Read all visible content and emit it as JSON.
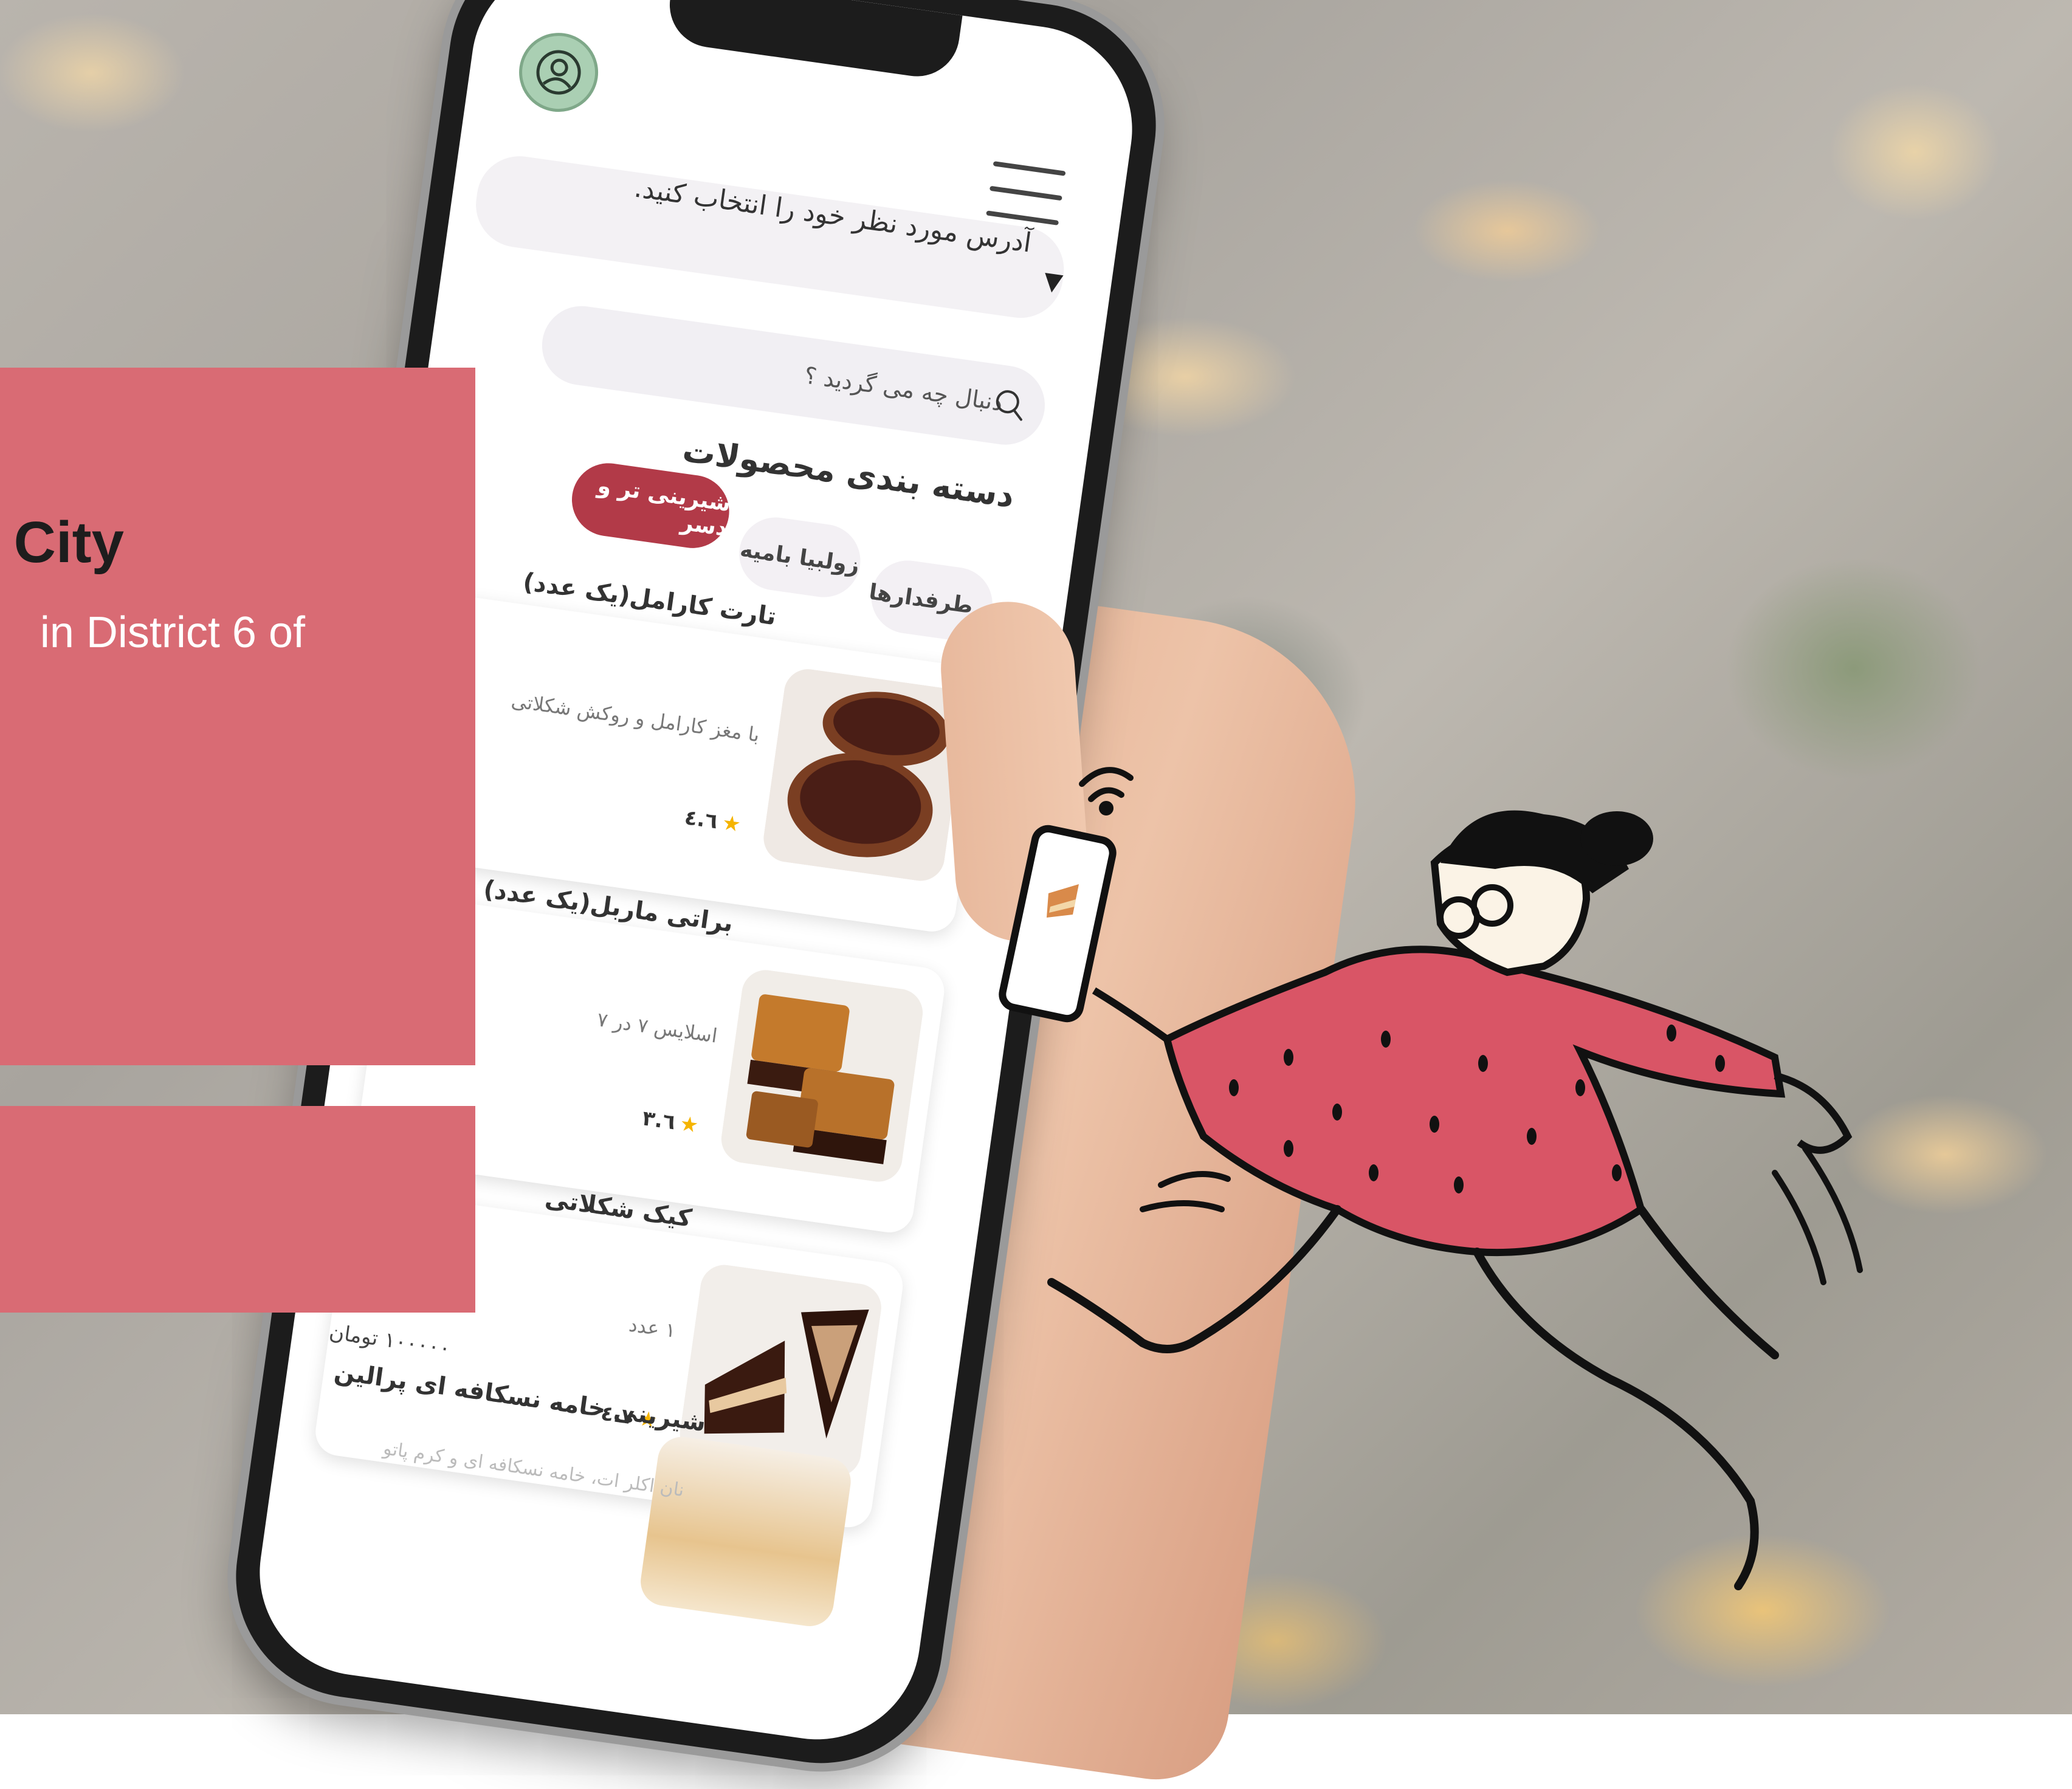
{
  "overlay": {
    "title": "City",
    "subtitle": "in District 6 of"
  },
  "app": {
    "address_prompt": "آدرس مورد نظر خود را انتخاب کنید.",
    "search_placeholder": "دنبال چه می گردید ؟",
    "categories_title": "دسته بندی محصولات",
    "categories": [
      "پرطرفدارها",
      "زولبیا بامیه",
      "شیرینی تر و دسر"
    ],
    "active_category_index": 2,
    "products": [
      {
        "title": "تارت کارامل(یک عدد)",
        "description": "با مغز کارامل و روکش شکلاتی",
        "rating": "٤.٦"
      },
      {
        "title": "براتی ماربل(یک عدد)",
        "description": "اسلایس ۷ در ۷",
        "rating": "٣.٦"
      },
      {
        "title": "کیک شکلاتی",
        "description": "۱ عدد",
        "rating": "٤.٧"
      },
      {
        "title": "شیرینی خامه نسکافه ای پرالین",
        "description": "نان اکلر ات، خامه نسکافه ای و کرم پاتو",
        "price": "۱۰۰۰۰۰ تومان"
      }
    ]
  },
  "colors": {
    "accent": "#b23a48",
    "panel": "#d96b74",
    "avatar_bg": "#aacfb3"
  }
}
